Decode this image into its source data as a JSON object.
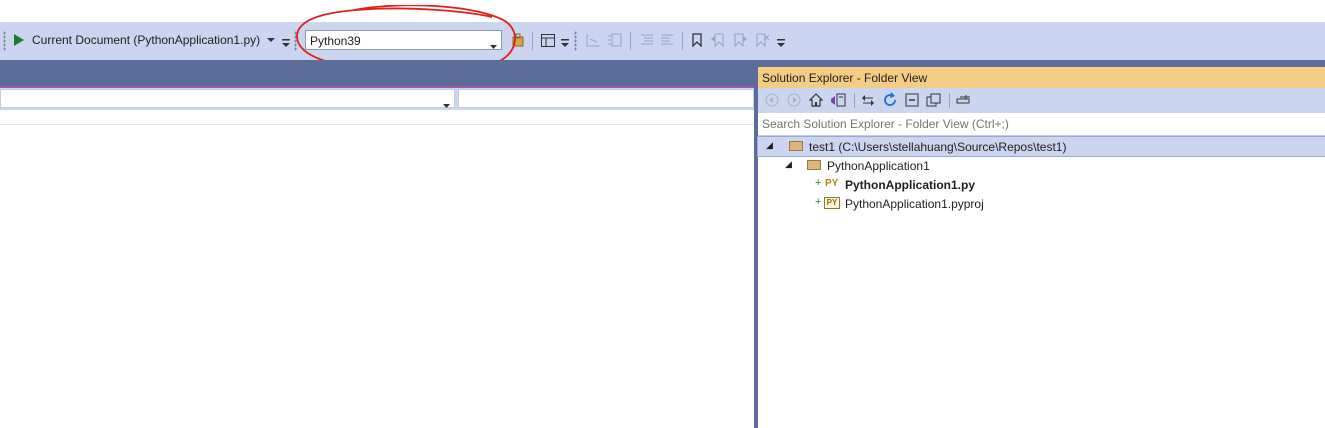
{
  "toolbar": {
    "run_label": "Current Document (PythonApplication1.py)",
    "environment": "Python39",
    "accent": "#1e7d32"
  },
  "solution_explorer": {
    "title": "Solution Explorer - Folder View",
    "search_placeholder": "Search Solution Explorer - Folder View (Ctrl+;)",
    "tree": [
      {
        "label": "test1 (C:\\Users\\stellahuang\\Source\\Repos\\test1)",
        "selected": true
      },
      {
        "label": "PythonApplication1"
      },
      {
        "badge": "PY",
        "label": "PythonApplication1.py",
        "bold": true
      },
      {
        "badge": "PY",
        "label": "PythonApplication1.pyproj"
      }
    ]
  },
  "colors": {
    "toolbar_bg": "#ccd5f0",
    "tool_window_header": "#f5cc84",
    "frame": "#5c6d99",
    "annotation": "#e0201b"
  }
}
